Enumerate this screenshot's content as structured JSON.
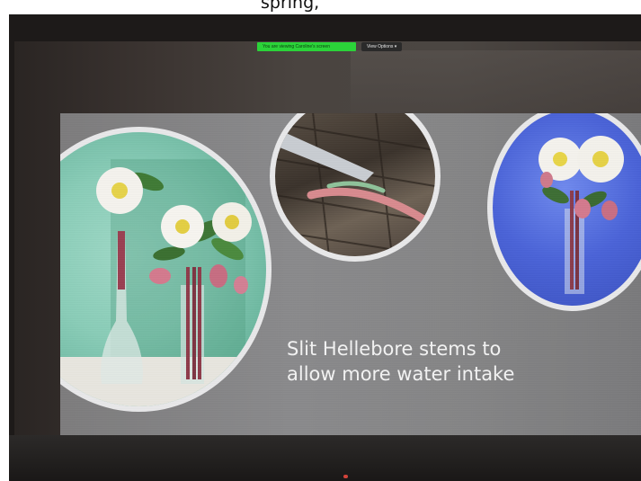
{
  "top_caption": "spring,",
  "meeting_toolbar": {
    "share_banner_label": "You are viewing Caroline's screen",
    "view_options_label": "View Options ▾"
  },
  "slide": {
    "title_lines": [
      "Slit Hellebore stems to",
      "allow more water intake"
    ]
  },
  "colors": {
    "share_banner": "#2bd339",
    "slide_background": "#858586",
    "circle_border": "#e9e9ea",
    "left_circle_bg": "#8acdb8",
    "right_circle_bg": "#4a63d8"
  },
  "icons": {
    "view_options_chevron": "chevron-down-icon"
  }
}
